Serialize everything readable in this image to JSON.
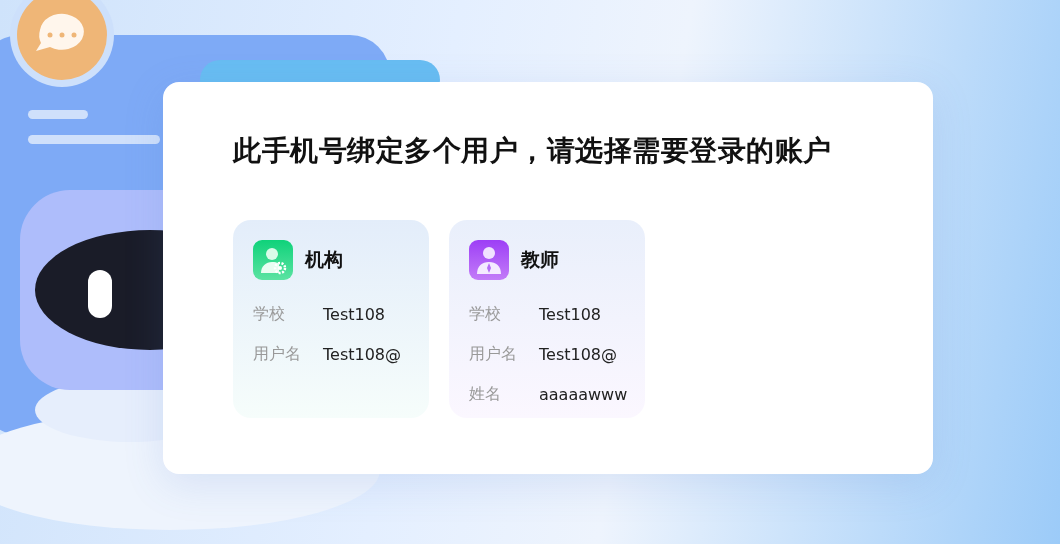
{
  "dialog": {
    "title": "此手机号绑定多个用户，请选择需要登录的账户",
    "accounts": [
      {
        "kind": "institution",
        "role": "机构",
        "fields": [
          {
            "label": "学校",
            "value": "Test108"
          },
          {
            "label": "用户名",
            "value": "Test108@"
          }
        ]
      },
      {
        "kind": "teacher",
        "role": "教师",
        "fields": [
          {
            "label": "学校",
            "value": "Test108"
          },
          {
            "label": "用户名",
            "value": "Test108@"
          },
          {
            "label": "姓名",
            "value": "aaaaawww"
          }
        ]
      }
    ]
  }
}
